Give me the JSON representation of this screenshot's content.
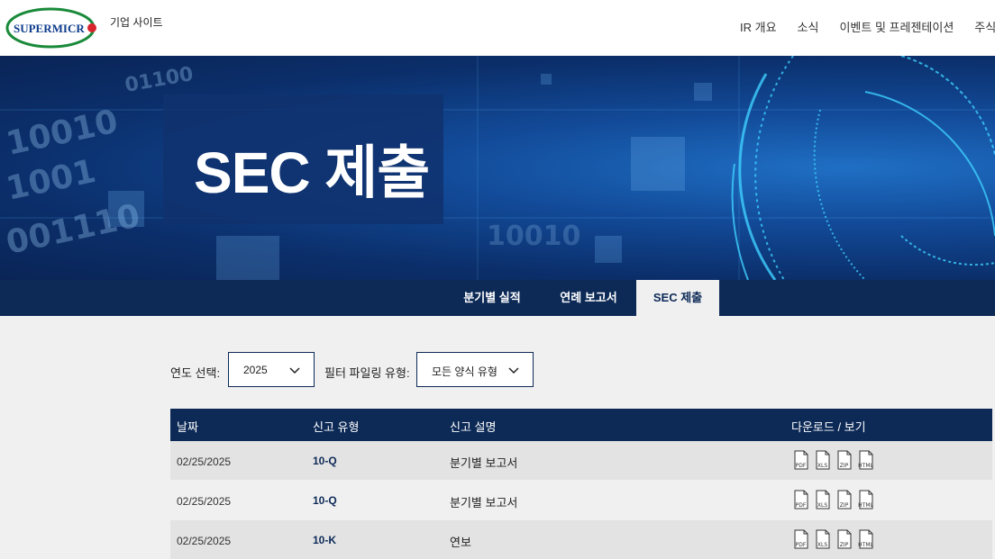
{
  "header": {
    "logo_text": "SUPERMICR",
    "corporate_link": "기업 사이트",
    "nav": [
      {
        "label": "IR 개요"
      },
      {
        "label": "소식"
      },
      {
        "label": "이벤트 및 프레젠테이션"
      },
      {
        "label": "주식 정"
      }
    ]
  },
  "hero": {
    "title": "SEC 제출"
  },
  "tabs": [
    {
      "label": "분기별 실적",
      "active": false
    },
    {
      "label": "연례 보고서",
      "active": false
    },
    {
      "label": "SEC 제출",
      "active": true
    }
  ],
  "filters": {
    "year_label": "연도 선택:",
    "year_value": "2025",
    "type_label": "필터 파일링 유형:",
    "type_value": "모든 양식 유형"
  },
  "table": {
    "headers": [
      "날짜",
      "신고 유형",
      "신고 설명",
      "다운로드 / 보기"
    ],
    "file_types": [
      "PDF",
      "XLS",
      "ZIP",
      "HTML"
    ],
    "rows": [
      {
        "date": "02/25/2025",
        "type": "10-Q",
        "description": "분기별 보고서"
      },
      {
        "date": "02/25/2025",
        "type": "10-Q",
        "description": "분기별 보고서"
      },
      {
        "date": "02/25/2025",
        "type": "10-K",
        "description": "연보"
      }
    ]
  },
  "colors": {
    "navy": "#0d2a57",
    "logo_green": "#1a8a3a",
    "logo_red": "#d9232d"
  }
}
